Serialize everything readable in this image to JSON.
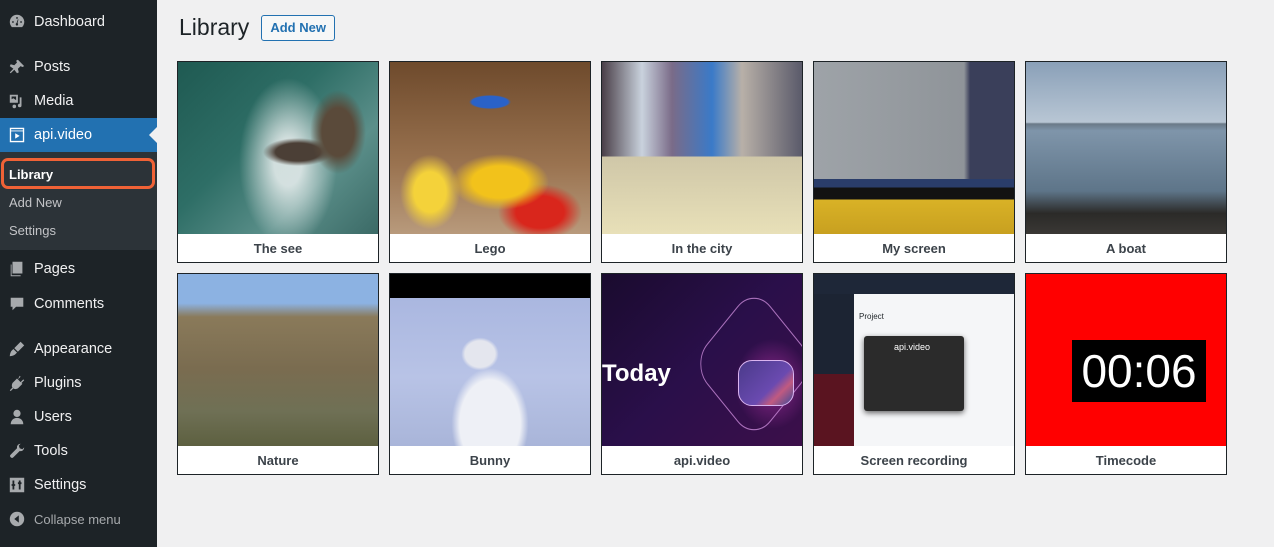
{
  "sidebar": {
    "items": [
      {
        "label": "Dashboard",
        "icon": "dashboard-icon"
      },
      {
        "label": "Posts",
        "icon": "pin-icon"
      },
      {
        "label": "Media",
        "icon": "media-icon"
      },
      {
        "label": "api.video",
        "icon": "video-icon",
        "active": true
      },
      {
        "label": "Pages",
        "icon": "pages-icon"
      },
      {
        "label": "Comments",
        "icon": "comment-icon"
      },
      {
        "label": "Appearance",
        "icon": "brush-icon"
      },
      {
        "label": "Plugins",
        "icon": "plugin-icon"
      },
      {
        "label": "Users",
        "icon": "user-icon"
      },
      {
        "label": "Tools",
        "icon": "wrench-icon"
      },
      {
        "label": "Settings",
        "icon": "sliders-icon"
      }
    ],
    "submenu": [
      {
        "label": "Library",
        "current": true
      },
      {
        "label": "Add New"
      },
      {
        "label": "Settings"
      }
    ],
    "collapse_label": "Collapse menu",
    "highlight_color": "#f06236",
    "accent_color": "#2271b1"
  },
  "main": {
    "title": "Library",
    "add_new_label": "Add New",
    "videos": [
      {
        "title": "The see"
      },
      {
        "title": "Lego"
      },
      {
        "title": "In the city"
      },
      {
        "title": "My screen"
      },
      {
        "title": "A boat"
      },
      {
        "title": "Nature"
      },
      {
        "title": "Bunny"
      },
      {
        "title": "api.video",
        "thumb_text": "Today"
      },
      {
        "title": "Screen recording",
        "thumb_text": "api.video",
        "thumb_heading": "Project"
      },
      {
        "title": "Timecode",
        "thumb_text": "00:06"
      }
    ]
  }
}
